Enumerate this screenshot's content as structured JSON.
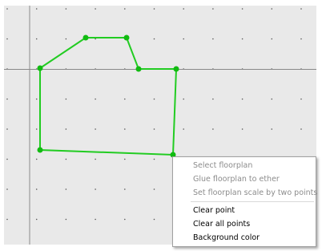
{
  "canvas": {
    "background_color": "#e9e9e9",
    "axis_color": "#8a8a8a",
    "grid_dot_color": "#555555",
    "polygon_color": "#22cc22",
    "point_color": "#11bb11"
  },
  "context_menu": {
    "items": [
      {
        "label": "Select floorplan",
        "enabled": false
      },
      {
        "label": "Glue floorplan to ether",
        "enabled": false
      },
      {
        "label": "Set floorplan scale by two points",
        "enabled": false
      },
      {
        "label": "Clear point",
        "enabled": true
      },
      {
        "label": "Clear all points",
        "enabled": true
      },
      {
        "label": "Background color",
        "enabled": true
      }
    ]
  }
}
